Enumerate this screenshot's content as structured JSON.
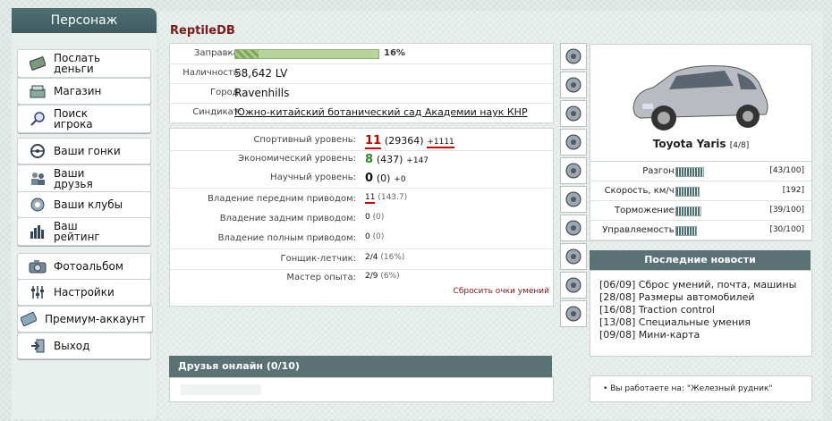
{
  "left": {
    "tab": "Персонаж",
    "items": [
      {
        "label": "Послать деньги",
        "icon": "money-icon"
      },
      {
        "label": "Магазин",
        "icon": "shop-icon"
      },
      {
        "label": "Поиск игрока",
        "icon": "search-icon"
      },
      {
        "label": "Ваши гонки",
        "icon": "steering-wheel-icon"
      },
      {
        "label": "Ваши друзья",
        "icon": "friends-icon"
      },
      {
        "label": "Ваши клубы",
        "icon": "clubs-icon"
      },
      {
        "label": "Ваш рейтинг",
        "icon": "rating-icon"
      },
      {
        "label": "Фотоальбом",
        "icon": "camera-icon"
      },
      {
        "label": "Настройки",
        "icon": "settings-icon"
      },
      {
        "label": "Премиум-аккаунт",
        "icon": "premium-icon"
      },
      {
        "label": "Выход",
        "icon": "exit-icon"
      }
    ]
  },
  "profile": {
    "name": "ReptileDB",
    "fuel_label": "Заправка:",
    "fuel_value": "16%",
    "fuel_fraction": 0.16,
    "cash_label": "Наличность:",
    "cash_value": "58,642 LV",
    "city_label": "Город:",
    "city_value": "Ravenhills",
    "syndicate_label": "Синдикат:",
    "syndicate_value": "Южно-китайский ботанический сад Академии наук КНР"
  },
  "levels": {
    "sport_label": "Спортивный уровень:",
    "sport_level": "11",
    "sport_points": "(29364)",
    "sport_delta": "+1111",
    "econ_label": "Экономический уровень:",
    "econ_level": "8",
    "econ_points": "(437)",
    "econ_delta": "+147",
    "sci_label": "Научный уровень:",
    "sci_level": "0",
    "sci_points": "(0)",
    "sci_delta": "+0"
  },
  "drive": {
    "front_label": "Владение передним приводом:",
    "front_value": "11",
    "front_points": "(143.7)",
    "rear_label": "Владение задним приводом:",
    "rear_value": "0",
    "rear_points": "(0)",
    "full_label": "Владение полным приводом:",
    "full_value": "0",
    "full_points": "(0)"
  },
  "skills": {
    "racer_label": "Гонщик-летчик:",
    "racer_value": "2/4",
    "racer_pct": "(16%)",
    "master_label": "Мастер опыта:",
    "master_value": "2/9",
    "master_pct": "(6%)",
    "reset_link": "Сбросить очки умений"
  },
  "side_icons": [
    "exhaust-icon",
    "tire-icon",
    "pipe-icon",
    "wing-icon",
    "gauge-icon",
    "gears-icon",
    "turbo-icon",
    "suspension-icon",
    "brake-icon",
    "nitro-icon"
  ],
  "car": {
    "name": "Toyota Yaris",
    "count": "[4/8]",
    "stats": [
      {
        "label": "Разгон:",
        "value": "[43/100]",
        "fraction": 0.43
      },
      {
        "label": "Скорость, км/ч:",
        "value": "[192]",
        "fraction": 0.35
      },
      {
        "label": "Торможение:",
        "value": "[39/100]",
        "fraction": 0.39
      },
      {
        "label": "Управляемость:",
        "value": "[30/100]",
        "fraction": 0.3
      }
    ],
    "body_color": "#b8bcc2"
  },
  "news": {
    "title": "Последние новости",
    "items": [
      "[06/09] Сброс умений, почта, машины",
      "[28/08] Размеры автомобилей",
      "[16/08] Traction control",
      "[13/08] Специальные умения",
      "[09/08] Мини-карта"
    ]
  },
  "work": {
    "text": "Вы работаете на: \"Железный рудник\""
  },
  "friends": {
    "title": "Друзья онлайн (0/10)"
  },
  "colors": {
    "header": "#5a7274",
    "accent_red": "#7a1a1a",
    "level_red": "#c00000",
    "level_green": "#2a8a2a"
  }
}
